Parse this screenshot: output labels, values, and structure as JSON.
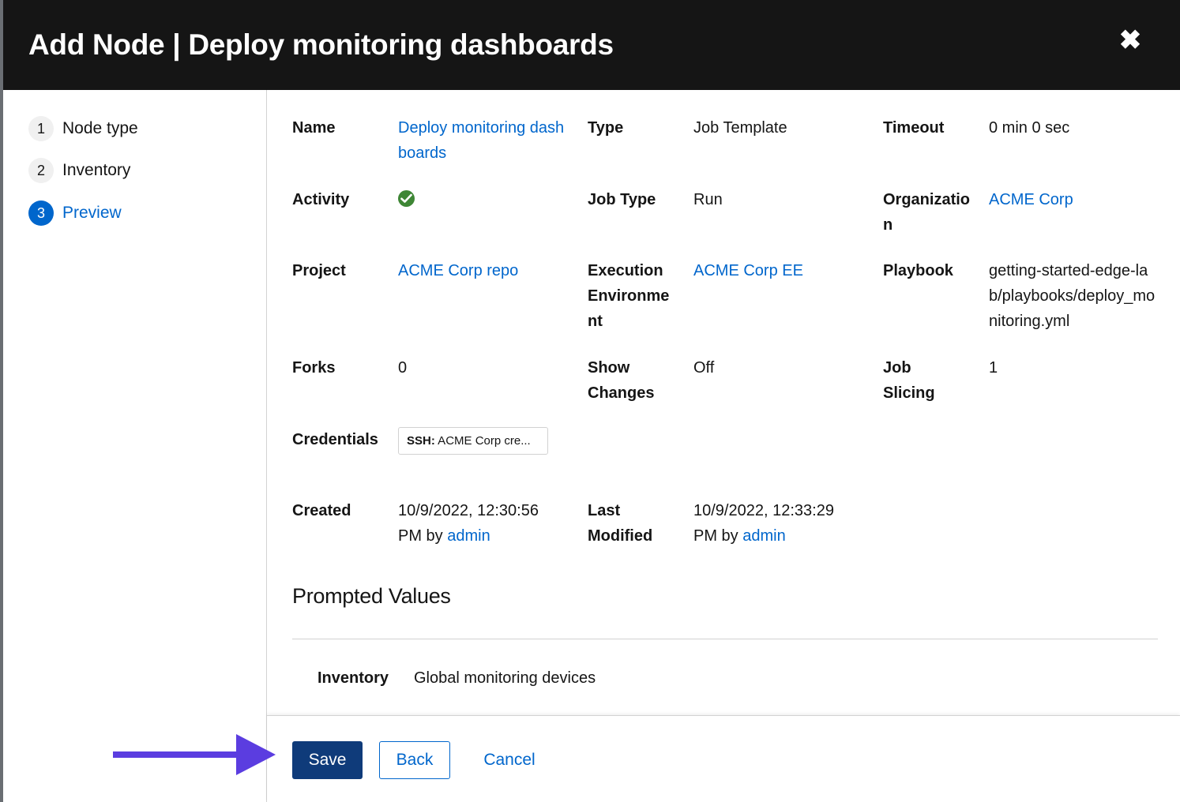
{
  "modal": {
    "title": "Add Node | Deploy monitoring dashboards",
    "close_icon": "close-icon (✖)"
  },
  "steps": [
    {
      "number": "1",
      "label": "Node type"
    },
    {
      "number": "2",
      "label": "Inventory"
    },
    {
      "number": "3",
      "label": "Preview",
      "current": true
    }
  ],
  "details": {
    "name": {
      "term": "Name",
      "value": "Deploy monitoring dashboards"
    },
    "type": {
      "term": "Type",
      "value": "Job Template"
    },
    "timeout": {
      "term": "Timeout",
      "value": "0 min 0 sec"
    },
    "activity": {
      "term": "Activity",
      "status": "success",
      "icon": "check-circle-icon"
    },
    "job_type": {
      "term": "Job Type",
      "value": "Run"
    },
    "organization": {
      "term": "Organization",
      "value": "ACME Corp"
    },
    "project": {
      "term": "Project",
      "value": "ACME Corp repo"
    },
    "execution_environment": {
      "term": "Execution Environment",
      "value": "ACME Corp EE"
    },
    "playbook": {
      "term": "Playbook",
      "value": "getting-started-edge-lab/playbooks/deploy_monitoring.yml"
    },
    "forks": {
      "term": "Forks",
      "value": "0"
    },
    "show_changes": {
      "term": "Show Changes",
      "value": "Off"
    },
    "job_slicing": {
      "term": "Job Slicing",
      "value": "1"
    },
    "credentials": {
      "term": "Credentials",
      "chip_type": "SSH:",
      "chip_value": " ACME Corp cre..."
    },
    "created": {
      "term": "Created",
      "date": "10/9/2022, 12:30:56 PM by ",
      "user": "admin"
    },
    "last_modified": {
      "term": "Last Modified",
      "date": "10/9/2022, 12:33:29 PM by ",
      "user": "admin"
    }
  },
  "prompted": {
    "title": "Prompted Values",
    "inventory_term": "Inventory",
    "inventory_value": "Global monitoring devices"
  },
  "footer": {
    "save_label": "Save",
    "back_label": "Back",
    "cancel_label": "Cancel"
  },
  "colors": {
    "header_bg": "#151515",
    "link": "#0066cc",
    "primary_button": "#0f3b7a",
    "success": "#3e8635",
    "annotation_arrow": "#5b3de0"
  }
}
